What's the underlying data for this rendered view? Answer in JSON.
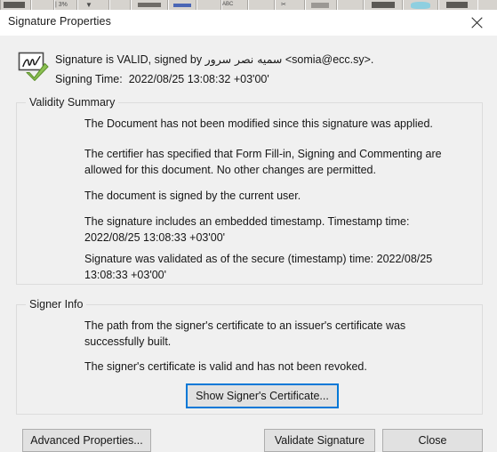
{
  "window": {
    "title": "Signature Properties",
    "close_icon": "close-icon"
  },
  "header": {
    "icon": "valid-signature-icon",
    "status_line": "Signature is VALID, signed by سميه نصر سرور <somia@ecc.sy>.",
    "signing_time_label": "Signing Time:",
    "signing_time_value": "2022/08/25 13:08:32 +03'00'"
  },
  "validity_summary": {
    "legend": "Validity Summary",
    "items": [
      "The Document has not been modified since this signature was applied.",
      "The certifier has specified that Form Fill-in, Signing and Commenting are allowed for this document. No other changes are permitted.",
      "The document is signed by the current user.",
      "The signature includes an embedded timestamp. Timestamp time: 2022/08/25 13:08:33 +03'00'",
      "Signature was validated as of the secure (timestamp) time: 2022/08/25 13:08:33 +03'00'"
    ]
  },
  "signer_info": {
    "legend": "Signer Info",
    "items": [
      "The path from the signer's certificate to an issuer's certificate was successfully built.",
      "The signer's certificate is valid and has not been revoked."
    ],
    "show_certificate_button": "Show Signer's Certificate..."
  },
  "footer": {
    "advanced_properties_button": "Advanced Properties...",
    "validate_signature_button": "Validate Signature",
    "close_button": "Close"
  },
  "colors": {
    "focus_ring": "#0078d7",
    "dialog_background": "#f0f0f0",
    "titlebar_background": "#ffffff",
    "button_face": "#e1e1e1",
    "check_green": "#7cb342"
  }
}
